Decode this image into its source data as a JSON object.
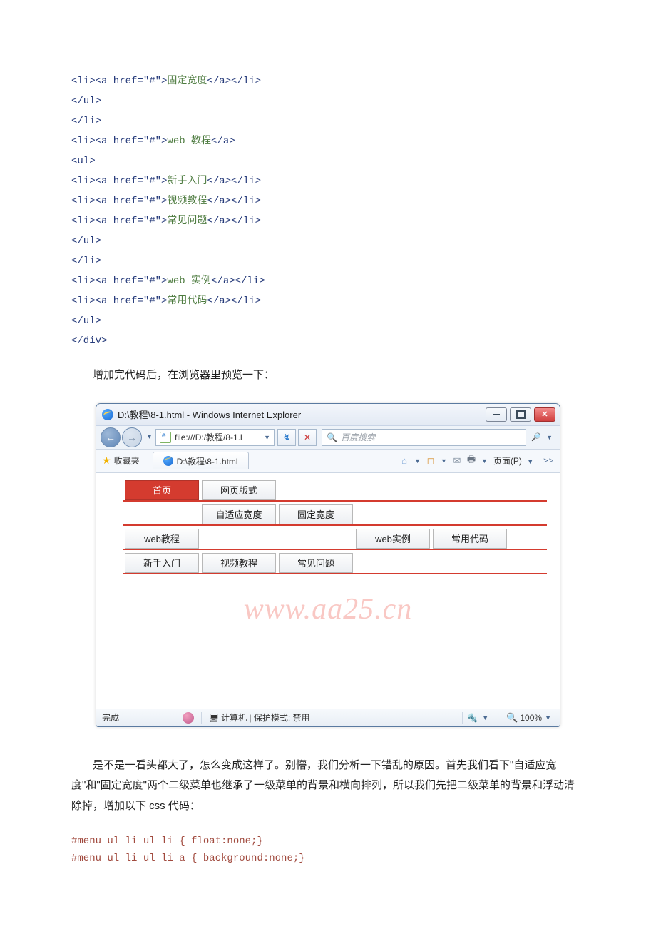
{
  "code": {
    "l1_open": "<li><a href=\"#\">",
    "l1_text": "固定宽度",
    "l1_close": "</a></li>",
    "l2": "</ul>",
    "l3": "</li>",
    "l4_open": "<li><a href=\"#\">",
    "l4_text": "web 教程",
    "l4_close": "</a>",
    "l5": "<ul>",
    "l6_open": "<li><a href=\"#\">",
    "l6_text": "新手入门",
    "l6_close": "</a></li>",
    "l7_open": "<li><a href=\"#\">",
    "l7_text": "视频教程",
    "l7_close": "</a></li>",
    "l8_open": "<li><a href=\"#\">",
    "l8_text": "常见问题",
    "l8_close": "</a></li>",
    "l9": "</ul>",
    "l10": "</li>",
    "l11_open": "<li><a href=\"#\">",
    "l11_text": "web 实例",
    "l11_close": "</a></li>",
    "l12_open": "<li><a href=\"#\">",
    "l12_text": "常用代码",
    "l12_close": "</a></li>",
    "l13": "</ul>",
    "l14": "</div>"
  },
  "para1": "增加完代码后，在浏览器里预览一下：",
  "ie": {
    "title": "D:\\教程\\8-1.html - Windows Internet Explorer",
    "url": "file:///D:/教程/8-1.l",
    "search_placeholder": "百度搜索",
    "fav_label": "收藏夹",
    "tab_label": "D:\\教程\\8-1.html",
    "page_menu": "页面(P)",
    "refresh_glyph": "↯",
    "stop_glyph": "✕",
    "more_glyph": ">>",
    "status_done": "完成",
    "status_mode": "计算机 | 保护模式: 禁用",
    "zoom": "100%"
  },
  "menu": {
    "home": "首页",
    "layout": "网页版式",
    "adaptive": "自适应宽度",
    "fixed": "固定宽度",
    "tutorial": "web教程",
    "example": "web实例",
    "common": "常用代码",
    "beginner": "新手入门",
    "video": "视频教程",
    "faq": "常见问题"
  },
  "watermark": "www.aa25.cn",
  "para2": "是不是一看头都大了，怎么变成这样了。别懵，我们分析一下错乱的原因。首先我们看下\"自适应宽度\"和\"固定宽度\"两个二级菜单也继承了一级菜单的背景和横向排列，所以我们先把二级菜单的背景和浮动清除掉，增加以下 css 代码：",
  "css1": "#menu ul li ul li { float:none;}",
  "css2": "#menu ul li ul li a { background:none;}"
}
